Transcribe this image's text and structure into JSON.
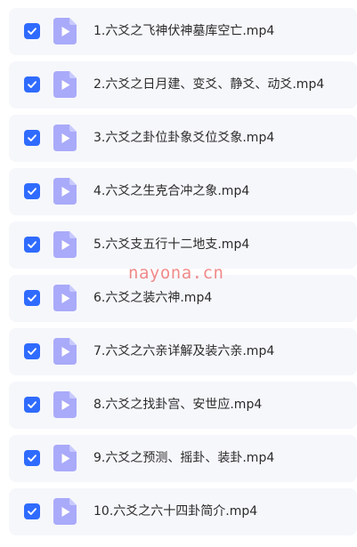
{
  "colors": {
    "checkbox": "#2f6bff",
    "file_icon": "#a9aaf9",
    "row_background": "#f6f7fb",
    "watermark": "#ee6a6a"
  },
  "files": [
    {
      "name": "1.六爻之飞神伏神墓库空亡.mp4",
      "checked": true,
      "icon": "video-file-icon"
    },
    {
      "name": "2.六爻之日月建、变爻、静爻、动爻.mp4",
      "checked": true,
      "icon": "video-file-icon"
    },
    {
      "name": "3.六爻之卦位卦象爻位爻象.mp4",
      "checked": true,
      "icon": "video-file-icon"
    },
    {
      "name": "4.六爻之生克合冲之象.mp4",
      "checked": true,
      "icon": "video-file-icon"
    },
    {
      "name": "5.六爻支五行十二地支.mp4",
      "checked": true,
      "icon": "video-file-icon"
    },
    {
      "name": "6.六爻之装六神.mp4",
      "checked": true,
      "icon": "video-file-icon"
    },
    {
      "name": "7.六爻之六亲详解及装六亲.mp4",
      "checked": true,
      "icon": "video-file-icon"
    },
    {
      "name": "8.六爻之找卦宫、安世应.mp4",
      "checked": true,
      "icon": "video-file-icon"
    },
    {
      "name": "9.六爻之预测、摇卦、装卦.mp4",
      "checked": true,
      "icon": "video-file-icon"
    },
    {
      "name": "10.六爻之六十四卦简介.mp4",
      "checked": true,
      "icon": "video-file-icon"
    }
  ],
  "watermark": "nayona.cn"
}
